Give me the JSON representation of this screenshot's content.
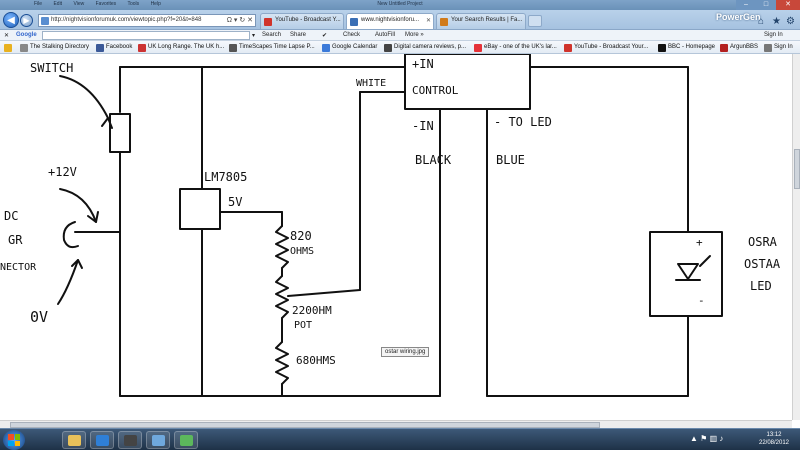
{
  "window": {
    "title": "New Untitled Project",
    "menu": [
      "File",
      "Edit",
      "View",
      "Favorites",
      "Tools",
      "Help"
    ],
    "brand": "PowerGen"
  },
  "nav": {
    "url": "http://nightvisionforumuk.com/viewtopic.php?f=20&t=848",
    "address_controls": "Ω ▾ ↻ ✕",
    "tabs": [
      {
        "label": "YouTube - Broadcast Y...",
        "color": "#d0332b"
      },
      {
        "label": "www.nightvisionforu...",
        "color": "#3b6fb5",
        "active": true
      },
      {
        "label": "Your Search Results | Fa...",
        "color": "#d07a1a"
      }
    ]
  },
  "google_toolbar": {
    "label": "Google",
    "search": "Search",
    "share": "Share",
    "check": "Check",
    "autofill": "AutoFill",
    "more": "More »",
    "signin": "Sign In"
  },
  "bookmarks": [
    {
      "label": "The Stalking Directory",
      "color": "#888888"
    },
    {
      "label": "Facebook",
      "color": "#3b5998"
    },
    {
      "label": "UK Long Range. The UK h...",
      "color": "#cc3333"
    },
    {
      "label": "TimeScapes Time Lapse P...",
      "color": "#555555"
    },
    {
      "label": "Google Calendar",
      "color": "#3b7ad9"
    },
    {
      "label": "Digital camera reviews, p...",
      "color": "#444444"
    },
    {
      "label": "eBay - one of the UK's lar...",
      "color": "#e53238"
    },
    {
      "label": "YouTube - Broadcast Your...",
      "color": "#d0332b"
    },
    {
      "label": "BBC - Homepage",
      "color": "#111111"
    },
    {
      "label": "ArgunBBS",
      "color": "#b32020"
    },
    {
      "label": "Sign In",
      "color": "#777777"
    }
  ],
  "diagram": {
    "labels": {
      "switch": "SWITCH",
      "plus12v": "+12V",
      "dc": "DC",
      "gr": "GR",
      "nector": "NECTOR",
      "zero_v": "0V",
      "regulator": "LM7805",
      "five_v": "5V",
      "r1_value": "820",
      "r1_unit": "OHMS",
      "pot_value": "2200HM",
      "pot_unit": "POT",
      "r2": "680HMS",
      "white": "WHITE",
      "plus_in": "+IN",
      "control": "CONTROL",
      "minus_in": "-IN",
      "black": "BLACK",
      "to_led": "- TO LED",
      "blue": "BLUE",
      "plus": "+",
      "minus": "-",
      "osram1": "OSRA",
      "osram2": "OSTAA",
      "led": "LED"
    }
  },
  "tooltip": "ostar wiring.jpg",
  "taskbar": {
    "time": "13:12",
    "date": "22/08/2012",
    "apps": [
      {
        "color": "#e8c15a"
      },
      {
        "color": "#2f7fd6"
      },
      {
        "color": "#444444"
      },
      {
        "color": "#6fa8dc"
      },
      {
        "color": "#5cb85c"
      }
    ]
  }
}
